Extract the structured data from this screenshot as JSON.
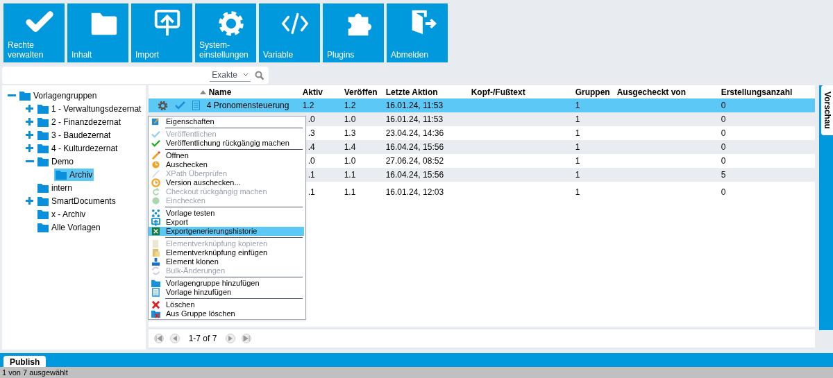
{
  "toolbar": [
    {
      "label": "Rechte verwalten"
    },
    {
      "label": "Inhalt"
    },
    {
      "label": "Import"
    },
    {
      "label": "System-einstellungen"
    },
    {
      "label": "Variable"
    },
    {
      "label": "Plugins"
    },
    {
      "label": "Abmelden"
    }
  ],
  "search": {
    "mode": "Exakte"
  },
  "tree": [
    {
      "label": "Vorlagengruppen",
      "expanded": true,
      "selected": false,
      "children": [
        {
          "label": "1 - Verwaltungsdezernat",
          "expanded": false,
          "selected": false
        },
        {
          "label": "2 - Finanzdezernat",
          "expanded": false,
          "selected": false
        },
        {
          "label": "3 - Baudezernat",
          "expanded": false,
          "selected": false
        },
        {
          "label": "4 - Kulturdezernat",
          "expanded": false,
          "selected": false
        },
        {
          "label": "Demo",
          "expanded": true,
          "selected": false,
          "children": [
            {
              "label": "Archiv",
              "selected": true
            }
          ]
        },
        {
          "label": "intern",
          "selected": false
        },
        {
          "label": "SmartDocuments",
          "expanded": false,
          "selected": false
        },
        {
          "label": "x - Archiv",
          "selected": false
        },
        {
          "label": "Alle Vorlagen",
          "selected": false
        }
      ]
    }
  ],
  "table": {
    "columns": [
      "Name",
      "Aktiv",
      "Veröffen",
      "Letzte Aktion",
      "Kopf-/Fußtext",
      "Gruppen",
      "Ausgecheckt von",
      "Erstellungsanzahl"
    ],
    "rows": [
      {
        "selected": true,
        "name": "4 Pronomensteuerung",
        "aktiv": "1.2",
        "published": "1.2",
        "last_action": "16.01.24, 11:53",
        "groups": "1",
        "count": "0"
      },
      {
        "selected": false,
        "aktiv": ".0",
        "published": "1.0",
        "last_action": "16.01.24, 11:53",
        "groups": "1",
        "count": "0"
      },
      {
        "selected": false,
        "aktiv": ".3",
        "published": "1.3",
        "last_action": "23.04.24, 14:36",
        "groups": "1",
        "count": "0"
      },
      {
        "selected": false,
        "aktiv": ".4",
        "published": "1.4",
        "last_action": "16.04.24, 15:56",
        "groups": "1",
        "count": "0"
      },
      {
        "selected": false,
        "aktiv": ".0",
        "published": "1.0",
        "last_action": "27.06.24, 08:52",
        "groups": "1",
        "count": "0"
      },
      {
        "selected": false,
        "aktiv": ".1",
        "published": "1.1",
        "last_action": "16.04.24, 15:56",
        "groups": "1",
        "count": "5"
      },
      {
        "selected": false,
        "aktiv": ".1",
        "published": "1.1",
        "last_action": "16.01.24, 12:03",
        "groups": "1",
        "count": "0"
      }
    ]
  },
  "context_menu": [
    {
      "kind": "item",
      "label": "Eigenschaften",
      "disabled": false,
      "selected": false
    },
    {
      "kind": "separator"
    },
    {
      "kind": "item",
      "label": "Veröffentlichen",
      "disabled": true,
      "selected": false
    },
    {
      "kind": "item",
      "label": "Veröffentlichung rückgängig machen",
      "disabled": false,
      "selected": false
    },
    {
      "kind": "separator"
    },
    {
      "kind": "item",
      "label": "Öffnen",
      "disabled": false,
      "selected": false
    },
    {
      "kind": "item",
      "label": "Auschecken",
      "disabled": false,
      "selected": false
    },
    {
      "kind": "item",
      "label": "XPath Überprüfen",
      "disabled": true,
      "selected": false
    },
    {
      "kind": "item",
      "label": "Version auschecken...",
      "disabled": false,
      "selected": false
    },
    {
      "kind": "item",
      "label": "Checkout rückgängig machen",
      "disabled": true,
      "selected": false
    },
    {
      "kind": "item",
      "label": "Einchecken",
      "disabled": true,
      "selected": false
    },
    {
      "kind": "separator"
    },
    {
      "kind": "item",
      "label": "Vorlage testen",
      "disabled": false,
      "selected": false
    },
    {
      "kind": "item",
      "label": "Export",
      "disabled": false,
      "selected": false
    },
    {
      "kind": "item",
      "label": "Exportgenerierungshistorie",
      "disabled": false,
      "selected": true
    },
    {
      "kind": "separator"
    },
    {
      "kind": "item",
      "label": "Elementverknüpfung kopieren",
      "disabled": true,
      "selected": false
    },
    {
      "kind": "item",
      "label": "Elementverknüpfung einfügen",
      "disabled": false,
      "selected": false
    },
    {
      "kind": "item",
      "label": "Element klonen",
      "disabled": false,
      "selected": false
    },
    {
      "kind": "item",
      "label": "Bulk-Änderungen",
      "disabled": true,
      "selected": false
    },
    {
      "kind": "separator"
    },
    {
      "kind": "item",
      "label": "Vorlagengruppe hinzufügen",
      "disabled": false,
      "selected": false
    },
    {
      "kind": "item",
      "label": "Vorlage hinzufügen",
      "disabled": false,
      "selected": false
    },
    {
      "kind": "separator"
    },
    {
      "kind": "item",
      "label": "Löschen",
      "disabled": false,
      "selected": false
    },
    {
      "kind": "item",
      "label": "Aus Gruppe löschen",
      "disabled": false,
      "selected": false
    }
  ],
  "pager": {
    "range": "1-7 of 7"
  },
  "side_tab": "Vorschau",
  "bottom_tabs": [
    {
      "label": "Publish",
      "selected": true
    }
  ],
  "status_bar": "1 von 7 ausgewählt"
}
